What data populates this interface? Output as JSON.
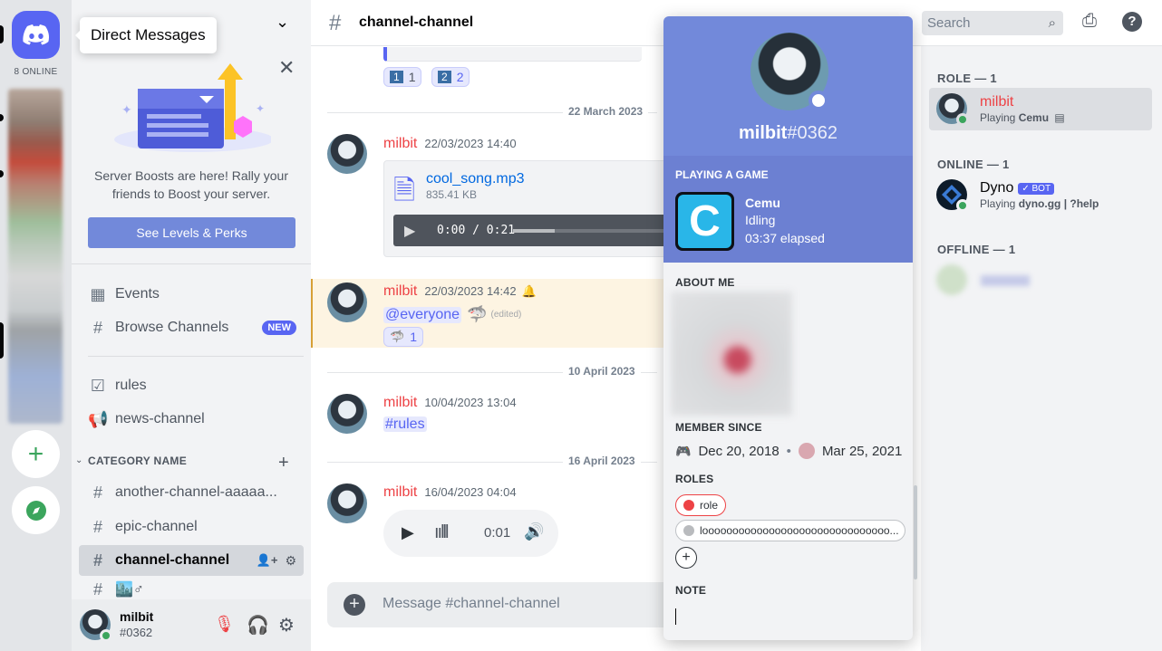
{
  "tooltip": {
    "direct_messages": "Direct Messages"
  },
  "rail": {
    "online_count": "8 ONLINE",
    "add_server_icon": "plus-icon",
    "explore_icon": "compass-icon"
  },
  "sidebar": {
    "boost": {
      "text": "Server Boosts are here! Rally your friends to Boost your server.",
      "button": "See Levels & Perks"
    },
    "events": "Events",
    "browse_channels": "Browse Channels",
    "new_badge": "NEW",
    "rules": "rules",
    "news_channel": "news-channel",
    "category": "CATEGORY NAME",
    "channels": [
      "another-channel-aaaaa...",
      "epic-channel",
      "channel-channel",
      "🏙️♂"
    ],
    "user": {
      "name": "milbit",
      "tag": "#0362"
    }
  },
  "chat": {
    "header": "channel-channel",
    "top_reactions": [
      {
        "emoji": "1",
        "count": "1"
      },
      {
        "emoji": "2",
        "count": "2"
      }
    ],
    "dates": [
      "22 March 2023",
      "10 April 2023",
      "16 April 2023"
    ],
    "messages": [
      {
        "author": "milbit",
        "time": "22/03/2023 14:40",
        "file_name": "cool_song.mp3",
        "file_size": "835.41 KB",
        "player_time": "0:00 / 0:21"
      },
      {
        "author": "milbit",
        "time": "22/03/2023 14:42",
        "mention": "@everyone",
        "edited": "(edited)",
        "reaction_count": "1"
      },
      {
        "author": "milbit",
        "time": "10/04/2023 13:04",
        "channel_mention": "#rules"
      },
      {
        "author": "milbit",
        "time": "16/04/2023 04:04",
        "voice_time": "0:01"
      }
    ],
    "input_placeholder": "Message #channel-channel"
  },
  "search": {
    "placeholder": "Search"
  },
  "members": {
    "groups": [
      {
        "title": "ROLE — 1",
        "name": "milbit",
        "activity_prefix": "Playing ",
        "activity": "Cemu"
      },
      {
        "title": "ONLINE — 1",
        "name": "Dyno",
        "badge": "✓ BOT",
        "activity_prefix": "Playing ",
        "activity": "dyno.gg | ?help"
      },
      {
        "title": "OFFLINE — 1"
      }
    ]
  },
  "profile": {
    "username": "milbit",
    "discriminator": "#0362",
    "playing_title": "PLAYING A GAME",
    "game": {
      "name": "Cemu",
      "state": "Idling",
      "elapsed": "03:37 elapsed",
      "icon_letter": "C"
    },
    "about_title": "ABOUT ME",
    "member_since_title": "MEMBER SINCE",
    "discord_since": "Dec 20, 2018",
    "server_since": "Mar 25, 2021",
    "roles_title": "ROLES",
    "roles": [
      {
        "name": "role",
        "color": "#ed4245"
      },
      {
        "name": "looooooooooooooooooooooooooooooo...",
        "color": "#b9bbbe"
      }
    ],
    "note_title": "NOTE",
    "status_color": "#3ba55d"
  }
}
